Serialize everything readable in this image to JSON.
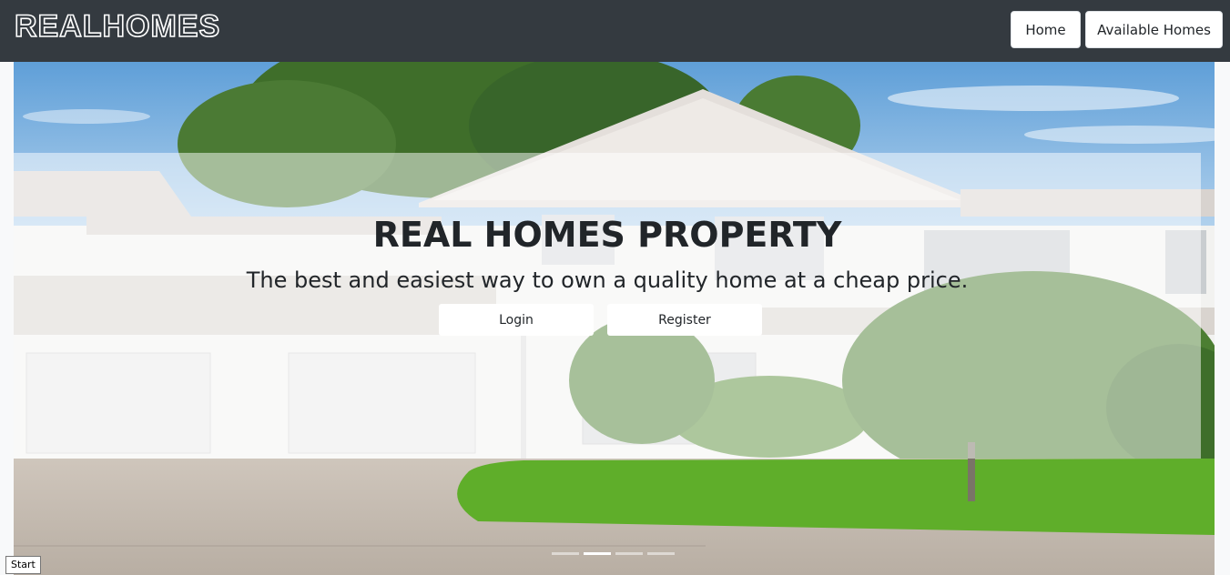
{
  "brand": {
    "name": "REALHOMES"
  },
  "nav": {
    "home_label": "Home",
    "available_label": "Available Homes"
  },
  "hero": {
    "title": "REAL HOMES PROPERTY",
    "subtitle": "The best and easiest way to own a quality home at a cheap price.",
    "login_label": "Login",
    "register_label": "Register"
  },
  "carousel": {
    "slide_count": 4,
    "active_index": 1
  },
  "status": {
    "start_label": "Start"
  },
  "colors": {
    "navbar": "#343a40",
    "sky": "#7fb2e0",
    "house": "#f2f2f0",
    "roof": "#d8d3cf",
    "lawn": "#5fae2a",
    "foliage": "#3f6e2a",
    "driveway": "#c9bfb4"
  }
}
